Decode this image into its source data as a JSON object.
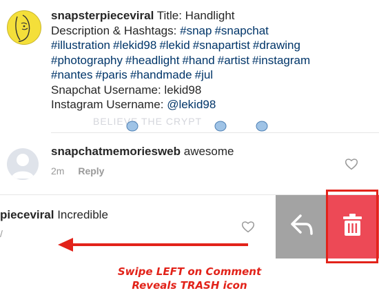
{
  "post": {
    "username": "snapsterpieceviral",
    "title": "Title: Handlight",
    "description_label": "Description & Hashtags:",
    "hashtags_line1": [
      "#snap",
      "#snapchat"
    ],
    "hashtags_line2": [
      "#illustration",
      "#lekid98",
      "#lekid",
      "#snapartist",
      "#drawing"
    ],
    "hashtags_line3": [
      "#photography",
      "#headlight",
      "#hand",
      "#artist",
      "#instagram"
    ],
    "hashtags_line4": [
      "#nantes",
      "#paris",
      "#handmade",
      "#jul"
    ],
    "snapchat_line": "Snapchat Username: lekid98",
    "instagram_label": "Instagram Username:",
    "instagram_handle": "@lekid98"
  },
  "watermark": "BELIEVE  THE  CRYPT",
  "comments": [
    {
      "username": "snapchatmemoriesweb",
      "text": "awesome",
      "time": "2m",
      "reply_label": "Reply"
    },
    {
      "username": "pieceviral",
      "text": "Incredible",
      "meta": "/"
    }
  ],
  "annotation": {
    "line1": "Swipe LEFT on Comment",
    "line2": "Reveals TRASH icon"
  },
  "colors": {
    "trash_bg": "#ed4956",
    "reply_bg": "#a3a3a3",
    "annotation_red": "#e2231a",
    "hashtag_blue": "#003569"
  },
  "icons": [
    "heart-icon",
    "reply-arrow-icon",
    "trash-icon",
    "swipe-left-arrow-icon"
  ]
}
